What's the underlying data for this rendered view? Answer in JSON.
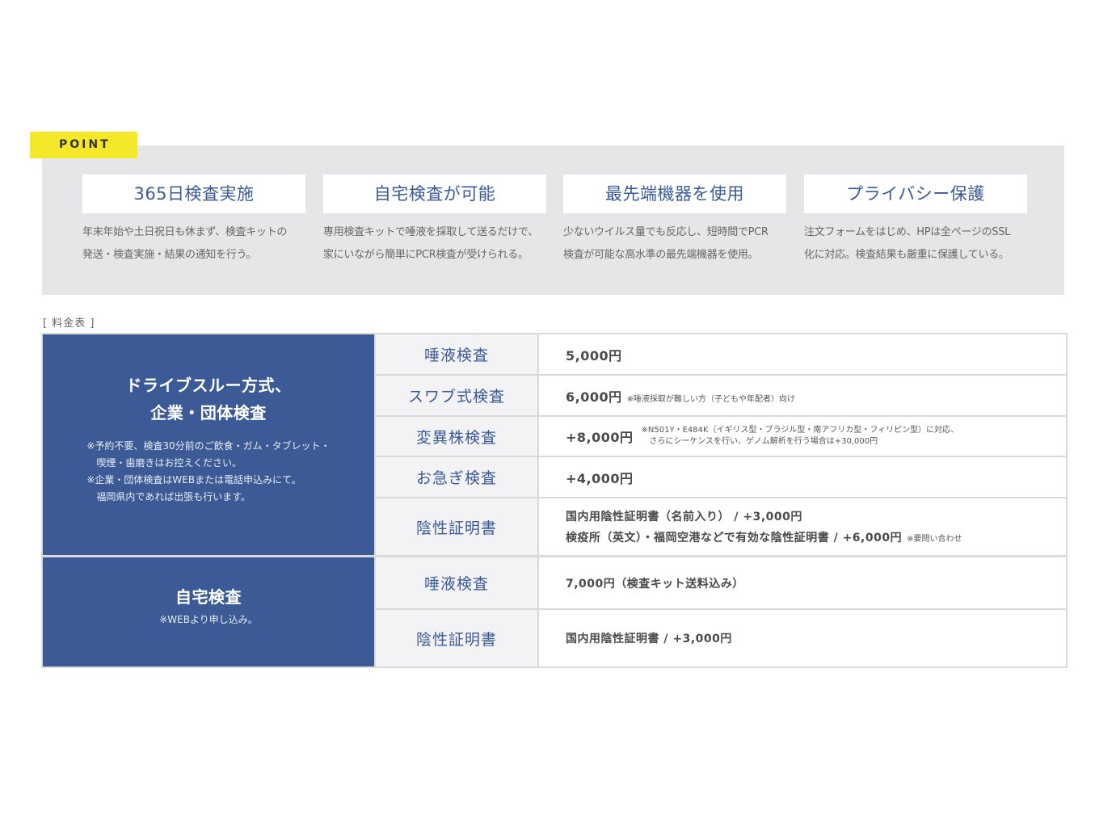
{
  "point": {
    "tag": "POINT",
    "cards": [
      {
        "title": "365日検査実施",
        "desc1": "年末年始や土日祝日も休まず、検査キットの",
        "desc2": "発送・検査実施・結果の通知を行う。"
      },
      {
        "title": "自宅検査が可能",
        "desc1": "専用検査キットで唾液を採取して送るだけで、",
        "desc2": "家にいながら簡単にPCR検査が受けられる。"
      },
      {
        "title": "最先端機器を使用",
        "desc1": "少ないウイルス量でも反応し、短時間でPCR",
        "desc2": "検査が可能な高水準の最先端機器を使用。"
      },
      {
        "title": "プライバシー保護",
        "desc1": "注文フォームをはじめ、HPは全ページのSSL",
        "desc2": "化に対応。検査結果も厳重に保護している。"
      }
    ]
  },
  "price_table": {
    "label": "[ 料金表 ]",
    "groups": [
      {
        "title1": "ドライブスルー方式、",
        "title2": "企業・団体検査",
        "notes": [
          "※予約不要、検査30分前のご飲食・ガム・タブレット・",
          "　喫煙・歯磨きはお控えください。",
          "※企業・団体検査はWEBまたは電話申込みにて。",
          "　福岡県内であれば出張も行います。"
        ],
        "rows": [
          {
            "name": "唾液検査",
            "price": "5,000円",
            "note": ""
          },
          {
            "name": "スワブ式検査",
            "price": "6,000円",
            "note": "※唾液採取が難しい方（子どもや年配者）向け"
          },
          {
            "name": "変異株検査",
            "price": "+8,000円",
            "note1": "※N501Y・E484K（イギリス型・ブラジル型・南アフリカ型・フィリピン型）に対応、",
            "note2": "　さらにシーケンスを行い、ゲノム解析を行う場合は+30,000円"
          },
          {
            "name": "お急ぎ検査",
            "price": "+4,000円",
            "note": ""
          },
          {
            "name": "陰性証明書",
            "line1": "国内用陰性証明書（名前入り） / +3,000円",
            "line2": "検疫所（英文）・福岡空港などで有効な陰性証明書 / +6,000円",
            "line2_note": "※要問い合わせ"
          }
        ]
      },
      {
        "title1": "自宅検査",
        "notes": [
          "※WEBより申し込み。"
        ],
        "rows": [
          {
            "name": "唾液検査",
            "price": "7,000円（検査キット送料込み）"
          },
          {
            "name": "陰性証明書",
            "price": "国内用陰性証明書 / +3,000円"
          }
        ]
      }
    ]
  }
}
